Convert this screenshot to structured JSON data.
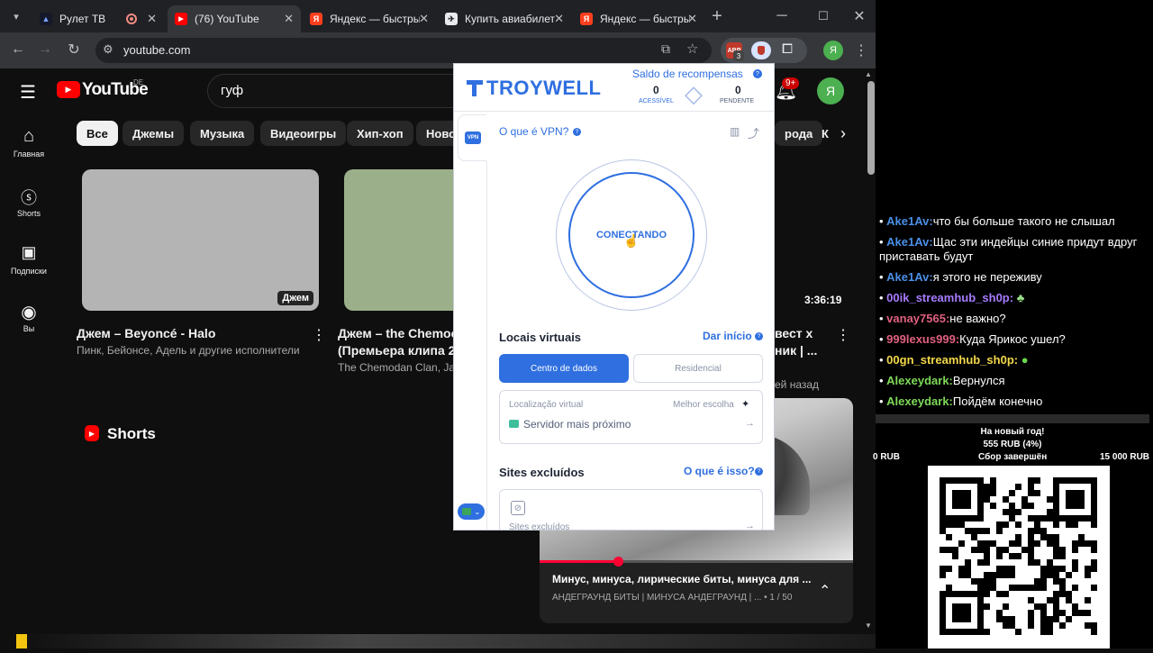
{
  "browser": {
    "tabs": [
      {
        "label": "Рулет ТВ",
        "icon": "ruletv-icon",
        "active": false
      },
      {
        "label": "",
        "icon": "record-icon",
        "active": false
      },
      {
        "label": "(76) YouTube",
        "icon": "youtube-icon",
        "active": true
      },
      {
        "label": "Яндекс — быстры",
        "icon": "yandex-icon",
        "active": false
      },
      {
        "label": "Купить авиабилет",
        "icon": "flight-icon",
        "active": false
      },
      {
        "label": "Яндекс — быстры",
        "icon": "yandex-icon",
        "active": false
      }
    ],
    "url": "youtube.com",
    "profile_initial": "Я",
    "ext_badge_count": "3"
  },
  "youtube": {
    "logo_text": "YouTube",
    "region": "DE",
    "search_value": "гуф",
    "notif_count": "9+",
    "avatar_initial": "Я",
    "sidebar": [
      {
        "label": "Главная",
        "icon": "home-icon"
      },
      {
        "label": "Shorts",
        "icon": "shorts-icon"
      },
      {
        "label": "Подписки",
        "icon": "subscriptions-icon"
      },
      {
        "label": "Вы",
        "icon": "you-icon"
      }
    ],
    "chips": [
      "Все",
      "Джемы",
      "Музыка",
      "Видеоигры",
      "Хип-хоп",
      "Ново",
      "рода",
      "К"
    ],
    "videos": [
      {
        "title": "Джем – Beyoncé - Halo",
        "meta": "Пинк, Бейонсе, Адель и другие исполнители",
        "badge": "Джем"
      },
      {
        "title": "Джем – the Chemoc",
        "title2": "(Премьера клипа 20",
        "meta": "The Chemodan Clan, Ja"
      },
      {
        "title": "вест х",
        "title2": "ник | ...",
        "meta": "ей назад",
        "duration": "3:36:19"
      }
    ],
    "shorts_label": "Shorts",
    "mini_player": {
      "title": "Минус, минуса, лирические биты, минуса для ...",
      "subtitle": "АНДЕГРАУНД БИТЫ | МИНУСА АНДЕГРАУНД | ... • 1 / 50",
      "progress": 0.25
    }
  },
  "extension": {
    "brand": "TROYWELL",
    "rewards_title": "Saldo de recompensas",
    "available_value": "0",
    "available_label": "ACESSÍVEL",
    "pending_value": "0",
    "pending_label": "PENDENTE",
    "vpn_tag": "VPN",
    "what_is_vpn": "O que é VPN?",
    "status": "CONECTANDO",
    "locations_title": "Locais virtuais",
    "start_link": "Dar início",
    "tab_datacenter": "Centro de dados",
    "tab_residential": "Residencial",
    "virtual_location_label": "Localização virtual",
    "best_choice_label": "Melhor escolha",
    "nearest_server": "Servidor mais próximo",
    "excluded_title": "Sites excluídos",
    "what_is_this": "O que é isso?",
    "excluded_placeholder": "Sites excluídos",
    "brand_color": "#2f6fe0"
  },
  "stream": {
    "chat": [
      {
        "name": "Ake1Av:",
        "text": "что бы больше такого не слышал",
        "color": "#4a8fe7"
      },
      {
        "name": "Ake1Av:",
        "text": "Щас эти индейцы синие придут вдруг приставать будут",
        "color": "#4a8fe7"
      },
      {
        "name": "Ake1Av:",
        "text": "я этого не переживу",
        "color": "#4a8fe7"
      },
      {
        "name": "00ik_streamhub_sh0p:",
        "text": "",
        "color": "#a77bff"
      },
      {
        "name": "vanay7565:",
        "text": "не важно?",
        "color": "#e0607e"
      },
      {
        "name": "999lexus999:",
        "text": "Куда Ярикос ушел?",
        "color": "#e0607e"
      },
      {
        "name": "00gn_streamhub_sh0p:",
        "text": "",
        "color": "#f3d84a"
      },
      {
        "name": "Alexeydark:",
        "text": "Вернулся",
        "color": "#7ed957"
      },
      {
        "name": "Alexeydark:",
        "text": "Пойдём конечно",
        "color": "#7ed957"
      }
    ],
    "goal_title": "На новый год!",
    "goal_amount": "555 RUB (4%)",
    "goal_min": "0 RUB",
    "goal_status": "Сбор завершён",
    "goal_max": "15 000 RUB"
  }
}
